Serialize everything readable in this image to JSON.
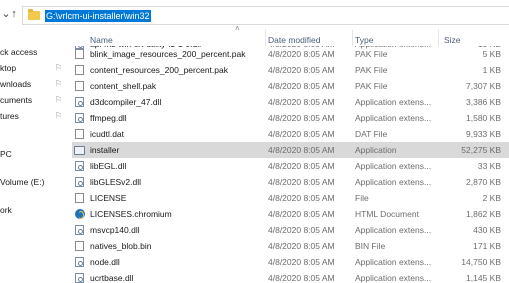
{
  "address": {
    "path": "G:\\vrlcm-ui-installer\\win32"
  },
  "nav": {
    "items": [
      {
        "label": "ck access",
        "pinned": false
      },
      {
        "label": "ktop",
        "pinned": true
      },
      {
        "label": "wnloads",
        "pinned": true
      },
      {
        "label": "cuments",
        "pinned": true
      },
      {
        "label": "tures",
        "pinned": true
      },
      {
        "label": "PC",
        "pinned": false
      },
      {
        "label": "Volume (E:)",
        "pinned": false
      },
      {
        "label": "ork",
        "pinned": false
      }
    ]
  },
  "columns": {
    "name": "Name",
    "date": "Date modified",
    "type": "Type",
    "size": "Size"
  },
  "files": [
    {
      "name": "api-ms-win-crt-utility-l1-1-0.dll",
      "date": "4/8/2020 8:05 AM",
      "type": "Application extens...",
      "size": "19 KB",
      "icon": "dll-icon",
      "partial": true
    },
    {
      "name": "blink_image_resources_200_percent.pak",
      "date": "4/8/2020 8:05 AM",
      "type": "PAK File",
      "size": "5 KB",
      "icon": "file-icon"
    },
    {
      "name": "content_resources_200_percent.pak",
      "date": "4/8/2020 8:05 AM",
      "type": "PAK File",
      "size": "1 KB",
      "icon": "file-icon"
    },
    {
      "name": "content_shell.pak",
      "date": "4/8/2020 8:05 AM",
      "type": "PAK File",
      "size": "7,307 KB",
      "icon": "file-icon"
    },
    {
      "name": "d3dcompiler_47.dll",
      "date": "4/8/2020 8:05 AM",
      "type": "Application extens...",
      "size": "3,386 KB",
      "icon": "dll-icon"
    },
    {
      "name": "ffmpeg.dll",
      "date": "4/8/2020 8:05 AM",
      "type": "Application extens...",
      "size": "1,580 KB",
      "icon": "dll-icon"
    },
    {
      "name": "icudtl.dat",
      "date": "4/8/2020 8:05 AM",
      "type": "DAT File",
      "size": "9,933 KB",
      "icon": "file-icon"
    },
    {
      "name": "installer",
      "date": "4/8/2020 8:05 AM",
      "type": "Application",
      "size": "52,275 KB",
      "icon": "application-icon",
      "selected": true
    },
    {
      "name": "libEGL.dll",
      "date": "4/8/2020 8:05 AM",
      "type": "Application extens...",
      "size": "33 KB",
      "icon": "dll-icon"
    },
    {
      "name": "libGLESv2.dll",
      "date": "4/8/2020 8:05 AM",
      "type": "Application extens...",
      "size": "2,870 KB",
      "icon": "dll-icon"
    },
    {
      "name": "LICENSE",
      "date": "4/8/2020 8:05 AM",
      "type": "File",
      "size": "2 KB",
      "icon": "file-icon"
    },
    {
      "name": "LICENSES.chromium",
      "date": "4/8/2020 8:05 AM",
      "type": "HTML Document",
      "size": "1,862 KB",
      "icon": "html-document-icon"
    },
    {
      "name": "msvcp140.dll",
      "date": "4/8/2020 8:05 AM",
      "type": "Application extens...",
      "size": "430 KB",
      "icon": "dll-icon"
    },
    {
      "name": "natives_blob.bin",
      "date": "4/8/2020 8:05 AM",
      "type": "BIN File",
      "size": "171 KB",
      "icon": "file-icon"
    },
    {
      "name": "node.dll",
      "date": "4/8/2020 8:05 AM",
      "type": "Application extens...",
      "size": "14,750 KB",
      "icon": "dll-icon"
    },
    {
      "name": "ucrtbase.dll",
      "date": "4/8/2020 8:05 AM",
      "type": "Application extens...",
      "size": "1,145 KB",
      "icon": "dll-icon"
    }
  ],
  "colors": {
    "selection": "#0078d7",
    "selected_row": "#d9d9d9",
    "header_text": "#4c607a",
    "secondary_text": "#6d6d6d",
    "folder": "#f2c94c"
  }
}
